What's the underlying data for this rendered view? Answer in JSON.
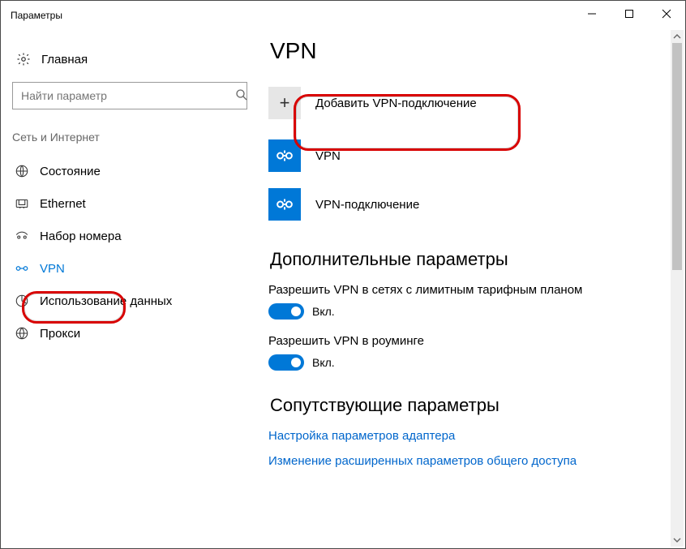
{
  "window": {
    "title": "Параметры"
  },
  "sidebar": {
    "home": "Главная",
    "search_placeholder": "Найти параметр",
    "category": "Сеть и Интернет",
    "items": [
      {
        "label": "Состояние"
      },
      {
        "label": "Ethernet"
      },
      {
        "label": "Набор номера"
      },
      {
        "label": "VPN"
      },
      {
        "label": "Использование данных"
      },
      {
        "label": "Прокси"
      }
    ]
  },
  "page": {
    "title": "VPN",
    "add_label": "Добавить VPN-подключение",
    "connections": [
      {
        "label": "VPN"
      },
      {
        "label": "VPN-подключение"
      }
    ],
    "advanced_heading": "Дополнительные параметры",
    "settings": [
      {
        "label": "Разрешить VPN в сетях с лимитным тарифным планом",
        "state": "Вкл."
      },
      {
        "label": "Разрешить VPN в роуминге",
        "state": "Вкл."
      }
    ],
    "related_heading": "Сопутствующие параметры",
    "links": [
      "Настройка параметров адаптера",
      "Изменение расширенных параметров общего доступа"
    ]
  }
}
